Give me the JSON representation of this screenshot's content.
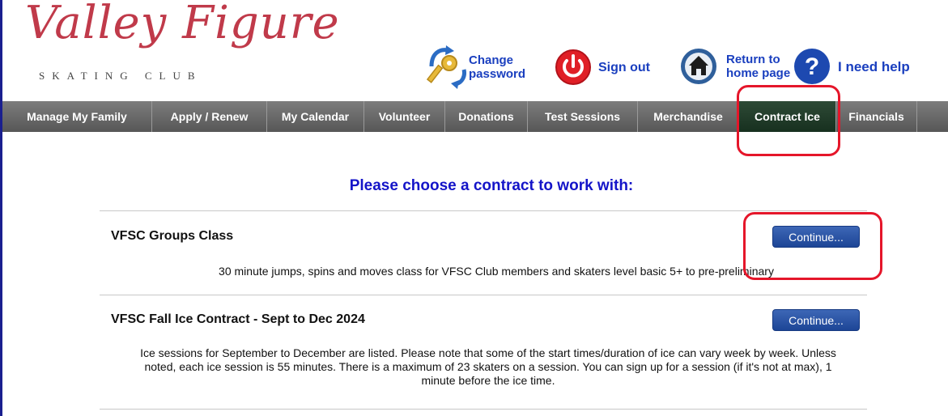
{
  "header": {
    "logo_script": "Valley Figure",
    "logo_sub": "SKATING CLUB",
    "change_password": [
      "Change",
      "password"
    ],
    "sign_out": "Sign out",
    "return_home": [
      "Return to",
      "home page"
    ],
    "help": "I need help"
  },
  "nav": {
    "items": [
      "Manage My Family",
      "Apply / Renew",
      "My Calendar",
      "Volunteer",
      "Donations",
      "Test Sessions",
      "Merchandise",
      "Contract Ice",
      "Financials"
    ],
    "active": "Contract Ice"
  },
  "main": {
    "title": "Please choose a contract to work with:",
    "contracts": [
      {
        "title": "VFSC Groups Class",
        "description": "30 minute jumps, spins and moves class for VFSC Club members and skaters level basic 5+ to pre-preliminary",
        "button": "Continue..."
      },
      {
        "title": "VFSC Fall Ice Contract - Sept to Dec 2024",
        "description": "Ice sessions for September to December are listed. Please note that some of the start times/duration of ice can vary week by week. Unless noted, each ice session is 55 minutes. There is a maximum of 23 skaters on a session. You can sign up for a session (if it's not at max), 1 minute before the ice time.",
        "button": "Continue..."
      }
    ]
  },
  "colors": {
    "link": "#1a3fbf",
    "title": "#1414c8",
    "nav_active": "#1f3f2a",
    "button": "#2a55a8",
    "annotation": "#e5162a",
    "logo": "#c03a4a"
  }
}
